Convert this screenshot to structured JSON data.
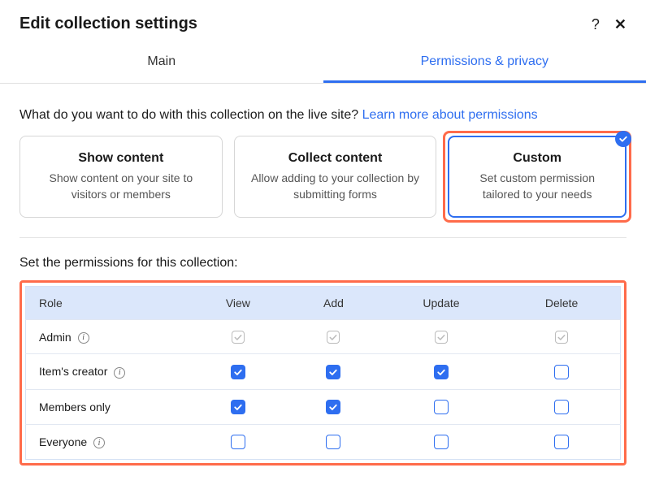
{
  "header": {
    "title": "Edit collection settings",
    "help_label": "?",
    "close_label": "✕"
  },
  "tabs": {
    "main": "Main",
    "permissions": "Permissions & privacy",
    "active": "permissions"
  },
  "question": {
    "text": "What do you want to do with this collection on the live site? ",
    "link": "Learn more about permissions"
  },
  "cards": [
    {
      "title": "Show content",
      "desc": "Show content on your site to visitors or members",
      "selected": false
    },
    {
      "title": "Collect content",
      "desc": "Allow adding to your collection by submitting forms",
      "selected": false
    },
    {
      "title": "Custom",
      "desc": "Set custom permission tailored to your needs",
      "selected": true
    }
  ],
  "permissions_heading": "Set the permissions for this collection:",
  "table": {
    "headers": {
      "role": "Role",
      "view": "View",
      "add": "Add",
      "update": "Update",
      "delete": "Delete"
    },
    "rows": [
      {
        "role": "Admin",
        "info": true,
        "view": "locked",
        "add": "locked",
        "update": "locked",
        "delete": "locked"
      },
      {
        "role": "Item's creator",
        "info": true,
        "view": "checked",
        "add": "checked",
        "update": "checked",
        "delete": "empty"
      },
      {
        "role": "Members only",
        "info": false,
        "view": "checked",
        "add": "checked",
        "update": "empty",
        "delete": "empty"
      },
      {
        "role": "Everyone",
        "info": true,
        "view": "empty",
        "add": "empty",
        "update": "empty",
        "delete": "empty"
      }
    ]
  }
}
